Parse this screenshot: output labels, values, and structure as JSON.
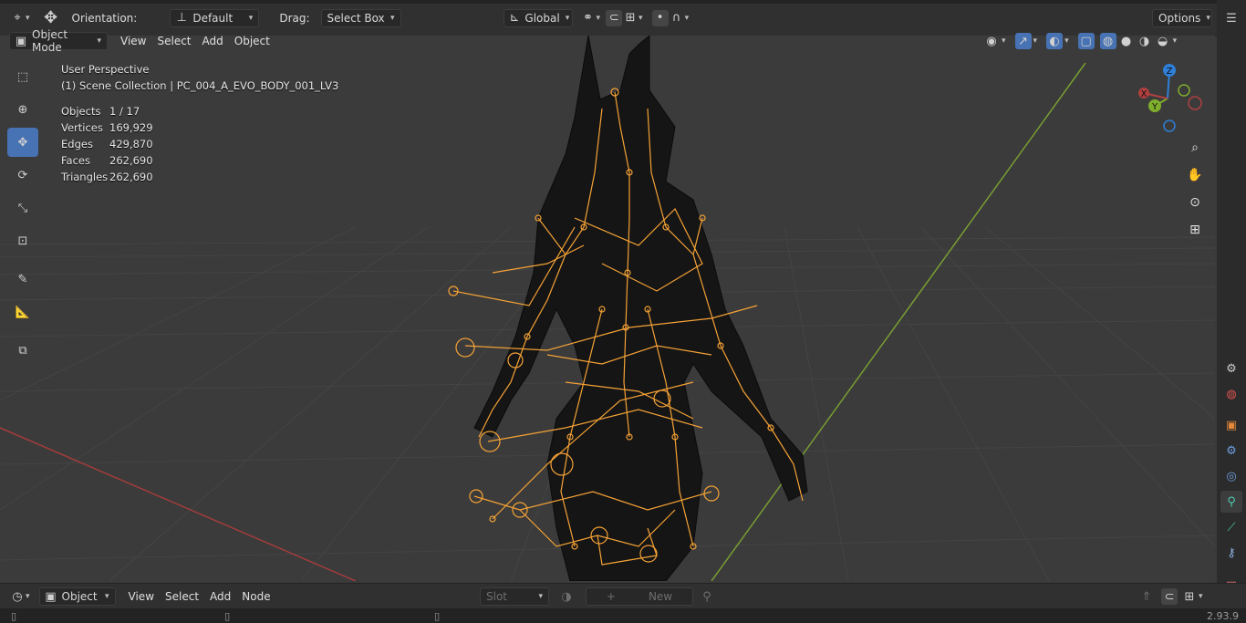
{
  "topbar": {
    "orientation_label": "Orientation:",
    "orientation_value": "Default",
    "drag_label": "Drag:",
    "drag_value": "Select Box",
    "transform_space": "Global",
    "options_label": "Options"
  },
  "header": {
    "mode": "Object Mode",
    "menu": [
      "View",
      "Select",
      "Add",
      "Object"
    ]
  },
  "overlay": {
    "perspective": "User Perspective",
    "collection": "(1) Scene Collection | PC_004_A_EVO_BODY_001_LV3",
    "stats": [
      {
        "k": "Objects",
        "v": "1 / 17"
      },
      {
        "k": "Vertices",
        "v": "169,929"
      },
      {
        "k": "Edges",
        "v": "429,870"
      },
      {
        "k": "Faces",
        "v": "262,690"
      },
      {
        "k": "Triangles",
        "v": "262,690"
      }
    ]
  },
  "gizmo": {
    "x": "X",
    "y": "Y",
    "z": "Z"
  },
  "nodebar": {
    "type": "Object",
    "menu": [
      "View",
      "Select",
      "Add",
      "Node"
    ],
    "slot": "Slot",
    "new_label": "New"
  },
  "status": {
    "version": "2.93.9"
  },
  "colors": {
    "accent": "#4772b3",
    "bone": "#f5a236",
    "x_axis": "#b04040",
    "y_axis": "#7fae2c",
    "z_axis": "#2f7fd8"
  }
}
